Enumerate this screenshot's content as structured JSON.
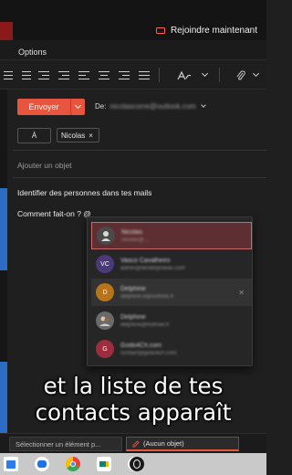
{
  "topbar": {
    "join_label": "Rejoindre maintenant"
  },
  "optionsbar": {
    "options_label": "Options"
  },
  "compose": {
    "send_label": "Envoyer",
    "from_label": "De:",
    "from_address": "nicolascorre@outlook.com",
    "to_label": "À",
    "recipient_chip": "Nicolas",
    "chip_remove": "×",
    "subject_placeholder": "Ajouter un objet",
    "body_line1": "Identifier des personnes dans tes mails",
    "body_line2": "Comment fait-on ? @"
  },
  "suggestions": [
    {
      "initials": "",
      "name": "Nicolas",
      "email": "nicolas@...",
      "color": "#555555",
      "photo": true
    },
    {
      "initials": "VC",
      "name": "Vasco Cavalheiro",
      "email": "admin@desktopclean.com",
      "color": "#4b3a7a",
      "photo": false
    },
    {
      "initials": "D",
      "name": "Delphine",
      "email": "delphine.b@outlook.fr",
      "color": "#b8741a",
      "photo": false
    },
    {
      "initials": "",
      "name": "Delphine",
      "email": "delphine@hotmail.fr",
      "color": "#6a6a6a",
      "photo": true
    },
    {
      "initials": "G",
      "name": "Godo4Ch.com",
      "email": "contact@godo4ch.com",
      "color": "#9b2d3c",
      "photo": false
    }
  ],
  "caption": {
    "line1": "et la liste de tes",
    "line2": "contacts apparaît"
  },
  "bottom_tabs": {
    "tab1": "Sélectionner un élément p...",
    "tab2": "(Aucun objet)"
  },
  "colors": {
    "accent": "#e8553f",
    "background": "#1f1f1f",
    "selected_row": "#5e2f32"
  },
  "icons": [
    "camera-icon",
    "chevron-down-icon",
    "close-icon",
    "pencil-icon",
    "chat-icon",
    "chrome-icon",
    "meet-icon",
    "youtube-icon",
    "opera-icon"
  ]
}
